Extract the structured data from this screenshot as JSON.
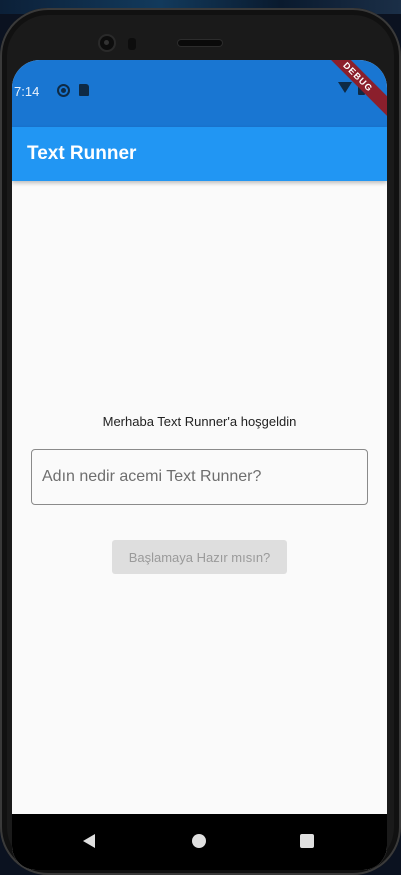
{
  "status_bar": {
    "time": "7:14",
    "icons": [
      "sync-icon",
      "sd-card-icon",
      "wifi-icon",
      "battery-icon"
    ]
  },
  "debug_banner": "DEBUG",
  "app_bar": {
    "title": "Text Runner"
  },
  "main": {
    "greeting": "Merhaba Text Runner'a hoşgeldin",
    "name_input": {
      "value": "",
      "placeholder": "Adın nedir acemi Text Runner?"
    },
    "start_button": "Başlamaya Hazır mısın?"
  },
  "nav_bar": {
    "icons": [
      "back-icon",
      "home-icon",
      "recents-icon"
    ]
  },
  "colors": {
    "app_bar": "#2196f3",
    "status_bar": "#1976d2",
    "background": "#fafafa",
    "button_disabled": "#dedede",
    "debug_banner": "#8b1f2c"
  }
}
